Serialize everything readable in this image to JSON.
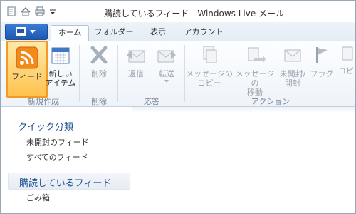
{
  "window": {
    "title": "購読しているフィード - Windows Live メール"
  },
  "quick_access": {
    "icons": [
      "new-document-icon",
      "home-icon",
      "print-icon",
      "dropdown-icon"
    ]
  },
  "tabs": [
    {
      "label": "ホーム",
      "active": true
    },
    {
      "label": "フォルダー",
      "active": false
    },
    {
      "label": "表示",
      "active": false
    },
    {
      "label": "アカウント",
      "active": false
    }
  ],
  "ribbon": {
    "buttons": {
      "feed": "フィード",
      "new_item_line1": "新しい",
      "new_item_line2": "アイテム",
      "delete": "削除",
      "reply": "返信",
      "forward": "転送",
      "copy_line1": "メッセージの",
      "copy_line2": "コピー",
      "move_line1": "メッセージの",
      "move_line2": "移動",
      "unread_line1": "未開封/",
      "unread_line2": "開封",
      "flag": "フラグ",
      "more": "コピ"
    },
    "groups": {
      "new": "新規作成",
      "delete": "削除",
      "respond": "応答",
      "actions": "アクション"
    }
  },
  "left_pane": {
    "quick_views_heading": "クイック分類",
    "quick_views_items": [
      "未開封のフィード",
      "すべてのフィード"
    ],
    "subscribed_heading": "購読しているフィード",
    "subscribed_items": [
      "ごみ箱"
    ]
  },
  "colors": {
    "accent": "#1f58b0",
    "feed_highlight": "#f39a25",
    "heading_blue": "#1f4f94"
  }
}
